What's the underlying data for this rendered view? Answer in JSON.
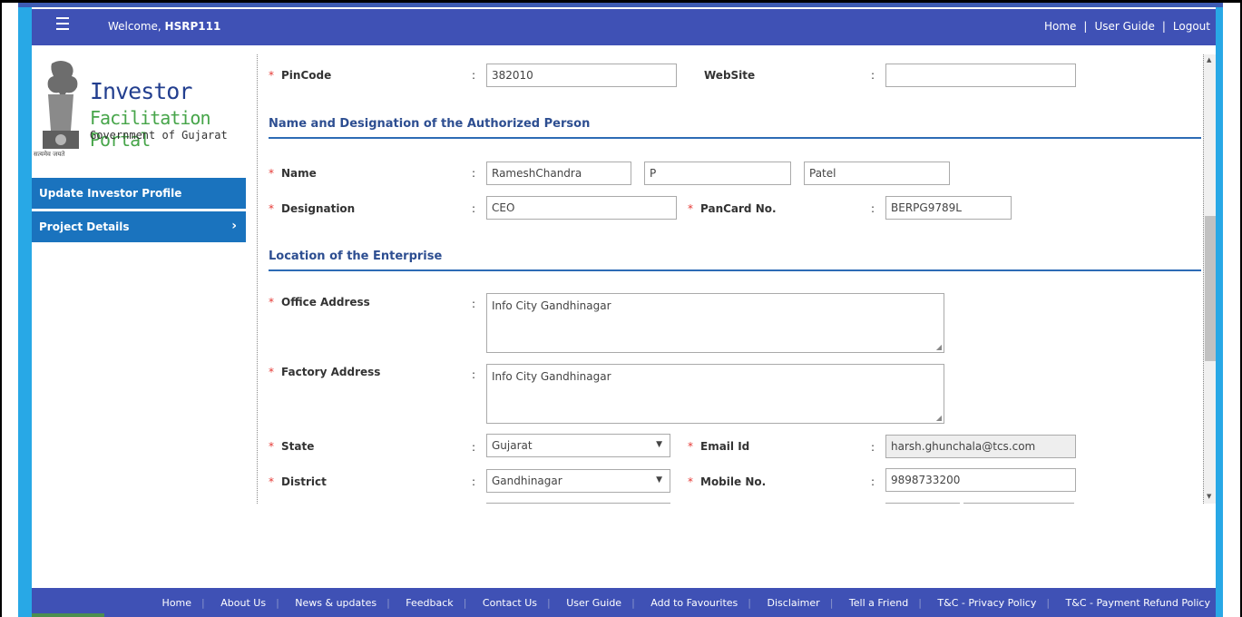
{
  "header": {
    "welcome_prefix": "Welcome,",
    "username": "HSRP111",
    "links": [
      "Home",
      "User Guide",
      "Logout"
    ],
    "link_separator": "|"
  },
  "logo": {
    "line1": "Investor",
    "line2": "Facilitation Portal",
    "line3": "Government of Gujarat",
    "emblem_caption": "सत्यमेव जयते"
  },
  "sidebar": {
    "items": [
      {
        "label": "Update Investor Profile"
      },
      {
        "label": "Project Details",
        "chevron": "›"
      }
    ]
  },
  "form": {
    "colon": ":",
    "required_mark": "*",
    "pincode": {
      "label": "PinCode",
      "value": "382010"
    },
    "website": {
      "label": "WebSite",
      "value": ""
    },
    "section_authorized": "Name and Designation of the Authorized Person",
    "name": {
      "label": "Name",
      "first": "RameshChandra",
      "middle": "P",
      "last": "Patel"
    },
    "designation": {
      "label": "Designation",
      "value": "CEO"
    },
    "pancard": {
      "label": "PanCard No.",
      "value": "BERPG9789L"
    },
    "section_location": "Location of the Enterprise",
    "office_address": {
      "label": "Office Address",
      "value": "Info City Gandhinagar"
    },
    "factory_address": {
      "label": "Factory Address",
      "value": "Info City Gandhinagar"
    },
    "state": {
      "label": "State",
      "value": "Gujarat"
    },
    "email": {
      "label": "Email Id",
      "value": "harsh.ghunchala@tcs.com"
    },
    "district": {
      "label": "District",
      "value": "Gandhinagar"
    },
    "mobile": {
      "label": "Mobile No.",
      "value": "9898733200"
    }
  },
  "footer": {
    "links": [
      "Home",
      "About Us",
      "News & updates",
      "Feedback",
      "Contact Us",
      "User Guide",
      "Add to Favourites",
      "Disclaimer",
      "Tell a Friend",
      "T&C - Privacy Policy",
      "T&C - Payment Refund Policy"
    ]
  },
  "icons": {
    "menu": "hamburger-icon",
    "chevron": "chevron-right-icon",
    "dropdown": "caret-down-icon"
  },
  "colors": {
    "header_bg": "#3f51b5",
    "sidebar_item_bg": "#1a73be",
    "section_title": "#2d4e91",
    "required": "#e53935",
    "accent_bar": "#28a8e6"
  }
}
